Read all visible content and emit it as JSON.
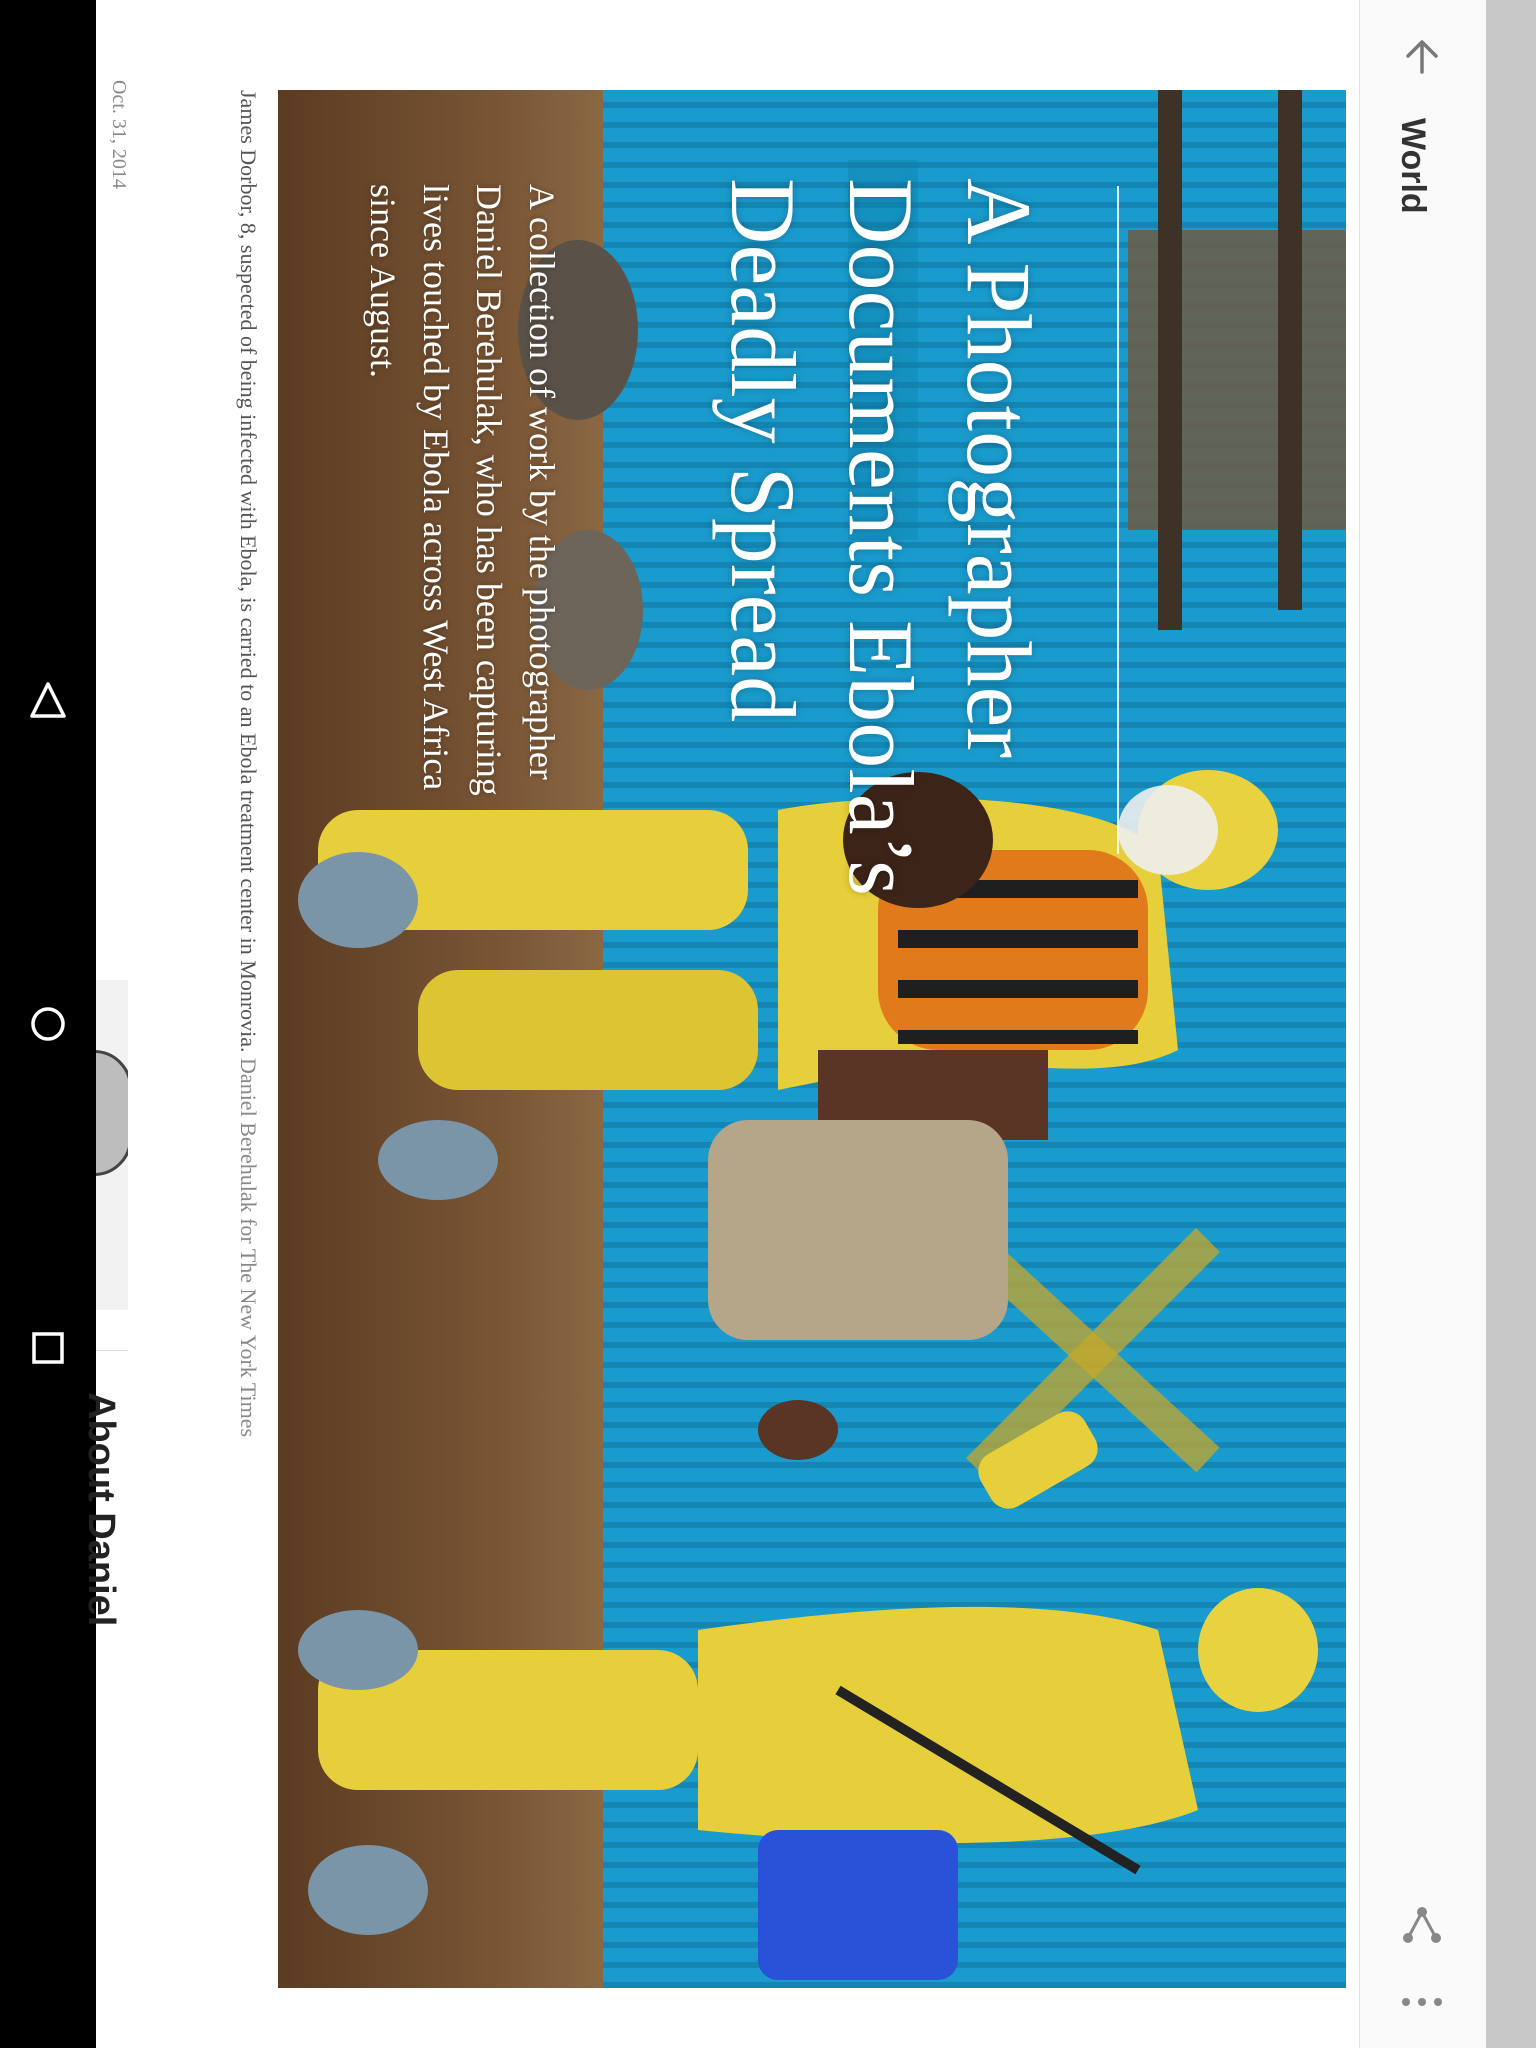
{
  "app_bar": {
    "section": "World",
    "icons": [
      "back-arrow-icon",
      "share-icon",
      "more-icon"
    ]
  },
  "article": {
    "headline": "A Photographer Documents Ebola’s Deadly Spread",
    "dek": "A collection of work by the photographer Daniel Berehulak, who has been capturing lives touched by Ebola across West Africa since August.",
    "caption": "James Dorbor, 8, suspected of being infected with Ebola, is carried to an Ebola treatment center in Monrovia.",
    "credit": "Daniel Berehulak for The New York Times",
    "date": "Oct. 31, 2014"
  },
  "next_card": {
    "title": "About Daniel"
  },
  "system_nav": [
    "back-icon",
    "home-icon",
    "recents-icon"
  ],
  "colors": {
    "wall_blue": "#1a9bcd",
    "suit_yellow": "#e6cf3a",
    "ground_brown": "#6a4a2c"
  }
}
